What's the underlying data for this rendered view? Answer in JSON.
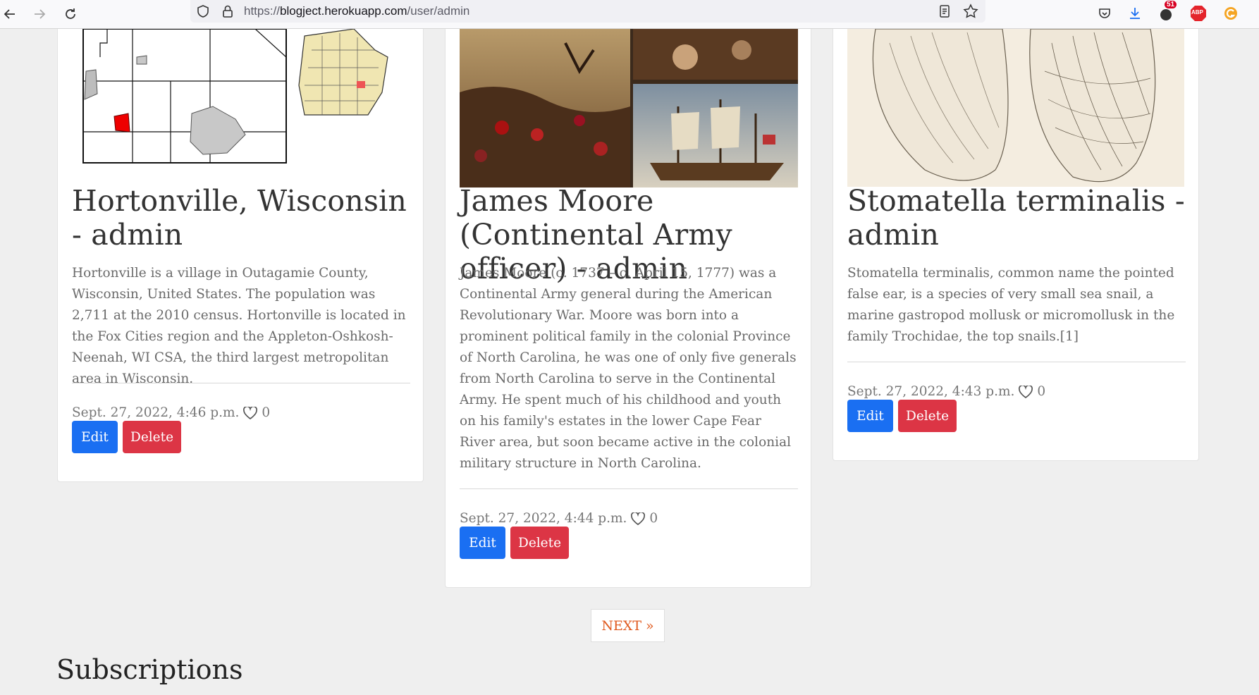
{
  "browser": {
    "url_prefix": "https://",
    "url_host": "blogject.herokuapp.com",
    "url_path": "/user/admin",
    "badge_count": "51",
    "abp_label": "ABP"
  },
  "posts": [
    {
      "title": "Hortonville, Wisconsin - admin",
      "image_alt": "Locator map of Hortonville, Wisconsin",
      "body": "Hortonville is a village in Outagamie County, Wisconsin, United States. The population was 2,711 at the 2010 census. Hortonville is located in the Fox Cities region and the Appleton-Oshkosh-Neenah, WI CSA, the third largest metropolitan area in Wisconsin.",
      "date": "Sept. 27, 2022, 4:46 p.m.",
      "likes": "0",
      "edit_label": "Edit",
      "delete_label": "Delete"
    },
    {
      "title": "James Moore (Continental Army officer) - admin",
      "image_alt": "Revolutionary War paintings collage",
      "body": "James Moore (c. 1737 – c. April 15, 1777) was a Continental Army general during the American Revolutionary War. Moore was born into a prominent political family in the colonial Province of North Carolina, he was one of only five generals from North Carolina to serve in the Continental Army. He spent much of his childhood and youth on his family's estates in the lower Cape Fear River area, but soon became active in the colonial military structure in North Carolina.",
      "date": "Sept. 27, 2022, 4:44 p.m.",
      "likes": "0",
      "edit_label": "Edit",
      "delete_label": "Delete"
    },
    {
      "title": "Stomatella terminalis - admin",
      "image_alt": "Sea snail shell illustration",
      "body": "Stomatella terminalis, common name the pointed false ear, is a species of very small sea snail, a marine gastropod mollusk or micromollusk in the family Trochidae, the top snails.[1]",
      "date": "Sept. 27, 2022, 4:43 p.m.",
      "likes": "0",
      "edit_label": "Edit",
      "delete_label": "Delete"
    }
  ],
  "pagination": {
    "next_label": "NEXT »"
  },
  "subscriptions": {
    "title": "Subscriptions"
  },
  "colors": {
    "edit": "#1a6ff2",
    "delete": "#dc3545",
    "next": "#e05a1f"
  }
}
